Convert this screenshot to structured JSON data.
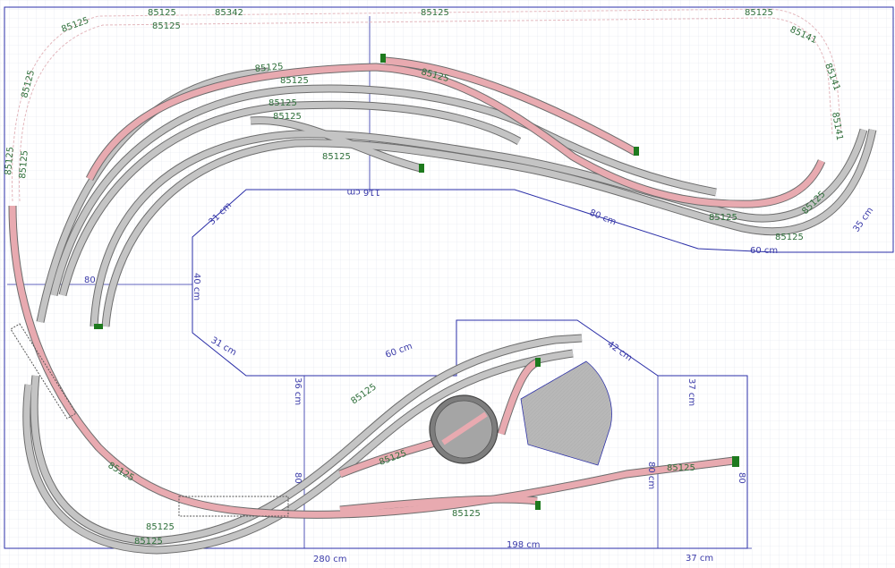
{
  "colors": {
    "background": "#ffffff",
    "grid": "#dfe4ec",
    "board_outline": "#2b2fa8",
    "track_grey": "#c4c4c4",
    "track_pink": "#e8aab0",
    "track_edge": "#6d6d6d",
    "label_green": "#2e6f3a",
    "dimension_blue": "#3a3aa8",
    "shed_fill": "#b8b8b8",
    "turntable_fill": "#7d7d7d"
  },
  "part_labels": {
    "top_1": "85125",
    "top_2": "85125",
    "top_3": "85342",
    "top_4": "85125",
    "top_5": "85125",
    "top_6": "85125",
    "top_7": "85141",
    "top_8": "85141",
    "top_9": "85141",
    "left_1": "85125",
    "left_2": "85125",
    "left_3": "85125",
    "mid_1": "85125",
    "mid_2": "85125",
    "mid_3": "85125",
    "mid_4": "85125",
    "mid_5": "85125",
    "mid_6": "85125",
    "bottom_1": "85125",
    "bottom_2": "85125",
    "bottom_3": "85125",
    "bottom_4": "85125",
    "yard_1": "85125",
    "yard_2": "85125",
    "yard_3": "85125",
    "right_1": "85125",
    "right_2": "85125",
    "right_3": "85125"
  },
  "dimensions": {
    "d_116": "116 cm",
    "d_80_diag": "80 cm",
    "d_60": "60 cm",
    "d_35": "35 cm",
    "d_31_top": "31 cm",
    "d_40": "40 cm",
    "d_80_left": "80",
    "d_31_bottom": "31 cm",
    "d_60_lower": "60 cm",
    "d_42": "42 cm",
    "d_36": "36 cm",
    "d_37_top": "37 cm",
    "d_80_mid": "80",
    "d_80_right_v": "80 cm",
    "d_80_right": "80",
    "d_280": "280 cm",
    "d_198": "198 cm",
    "d_37_bottom": "37 cm"
  }
}
